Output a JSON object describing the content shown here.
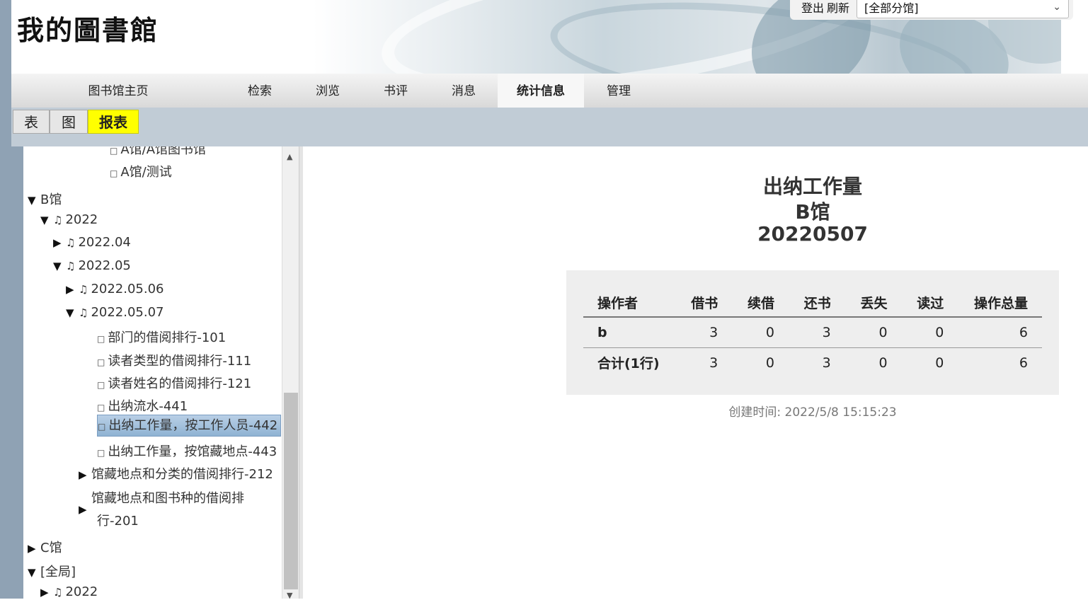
{
  "header": {
    "logo": "我的圖書館",
    "logout": "登出",
    "refresh": "刷新",
    "branch_select": "[全部分馆]"
  },
  "nav": {
    "items": [
      "图书馆主页",
      "检索",
      "浏览",
      "书评",
      "消息",
      "统计信息",
      "管理"
    ],
    "active": "统计信息"
  },
  "subtabs": {
    "items": [
      "表",
      "图",
      "报表"
    ],
    "active": "报表"
  },
  "tree": {
    "nodes": [
      {
        "label": "A馆/A馆图书馆",
        "kind": "leaf"
      },
      {
        "label": "A馆/测试",
        "kind": "leaf"
      },
      {
        "label": "B馆",
        "kind": "branch-open"
      },
      {
        "label": "2022",
        "kind": "folder-open"
      },
      {
        "label": "2022.04",
        "kind": "folder-closed"
      },
      {
        "label": "2022.05",
        "kind": "folder-open"
      },
      {
        "label": "2022.05.06",
        "kind": "folder-closed"
      },
      {
        "label": "2022.05.07",
        "kind": "folder-open"
      },
      {
        "label": "部门的借阅排行-101",
        "kind": "leaf"
      },
      {
        "label": "读者类型的借阅排行-111",
        "kind": "leaf"
      },
      {
        "label": "读者姓名的借阅排行-121",
        "kind": "leaf"
      },
      {
        "label": "出纳流水-441",
        "kind": "leaf"
      },
      {
        "label": "出纳工作量，按工作人员-442",
        "kind": "leaf-selected"
      },
      {
        "label": "出纳工作量，按馆藏地点-443",
        "kind": "leaf"
      },
      {
        "label": "馆藏地点和分类的借阅排行-212",
        "kind": "branch-closed"
      },
      {
        "label": "馆藏地点和图书种的借阅排",
        "label2": "行-201",
        "kind": "branch-closed"
      },
      {
        "label": "C馆",
        "kind": "branch-closed"
      },
      {
        "label": "[全局]",
        "kind": "branch-open"
      },
      {
        "label": "2022",
        "kind": "folder-closed"
      }
    ]
  },
  "report": {
    "title": "出纳工作量",
    "branch": "B馆",
    "date": "20220507",
    "columns": [
      "操作者",
      "借书",
      "续借",
      "还书",
      "丢失",
      "读过",
      "操作总量"
    ],
    "rows": [
      [
        "b",
        "3",
        "0",
        "3",
        "0",
        "0",
        "6"
      ],
      [
        "合计(1行)",
        "3",
        "0",
        "3",
        "0",
        "0",
        "6"
      ]
    ],
    "created_label": "创建时间: 2022/5/8 15:15:23"
  }
}
